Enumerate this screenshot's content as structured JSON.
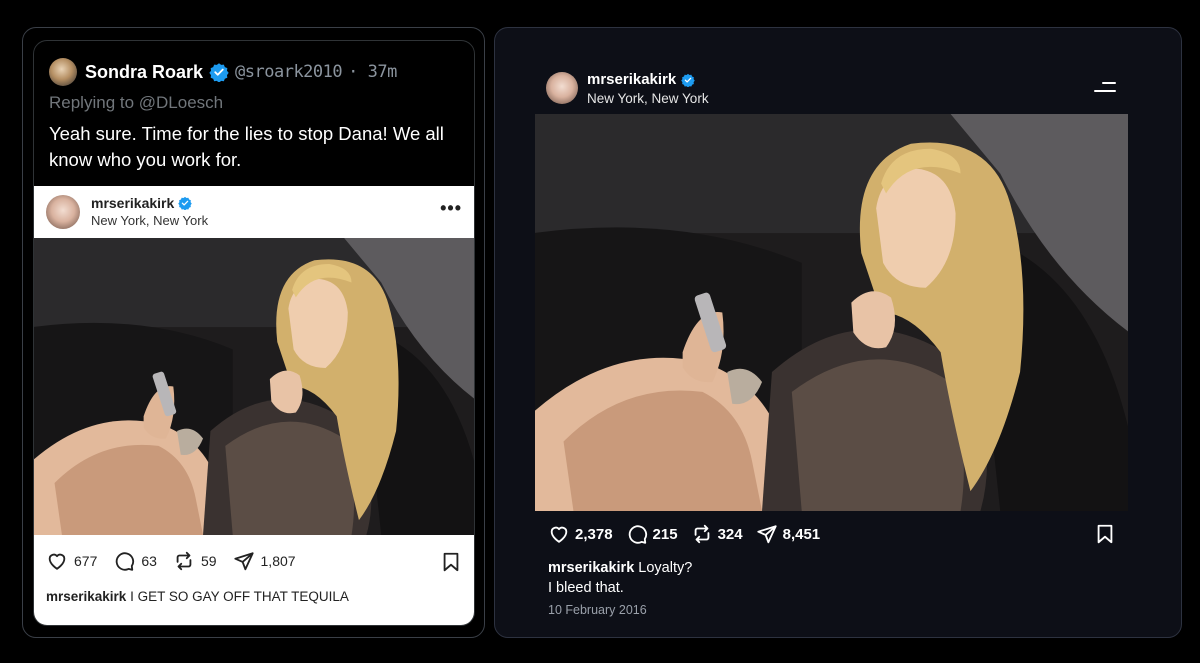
{
  "tweet": {
    "display_name": "Sondra Roark",
    "handle": "@sroark2010",
    "time": "· 37m",
    "replying_to": "Replying to @DLoesch",
    "text": "Yeah sure. Time for the lies to stop Dana! We all know who you work for."
  },
  "embedded_post": {
    "username": "mrserikakirk",
    "location": "New York, New York",
    "more_icon": "•••",
    "likes": "677",
    "comments": "63",
    "reposts": "59",
    "shares": "1,807",
    "caption_user": "mrserikakirk",
    "caption_text": " I GET SO GAY OFF THAT TEQUILA"
  },
  "post": {
    "username": "mrserikakirk",
    "location": "New York, New York",
    "likes": "2,378",
    "comments": "215",
    "reposts": "324",
    "shares": "8,451",
    "caption_user": "mrserikakirk",
    "caption_line1": " Loyalty?",
    "caption_line2": "I bleed that.",
    "date": "10 February 2016"
  },
  "icons": {
    "verified": "verified-badge-icon",
    "heart": "heart-icon",
    "comment": "comment-icon",
    "repost": "repost-icon",
    "share": "send-icon",
    "save": "bookmark-icon",
    "menu": "menu-icon"
  },
  "colors": {
    "verified_blue": "#1d9bf0",
    "ig_verified_blue": "#3897f0"
  }
}
